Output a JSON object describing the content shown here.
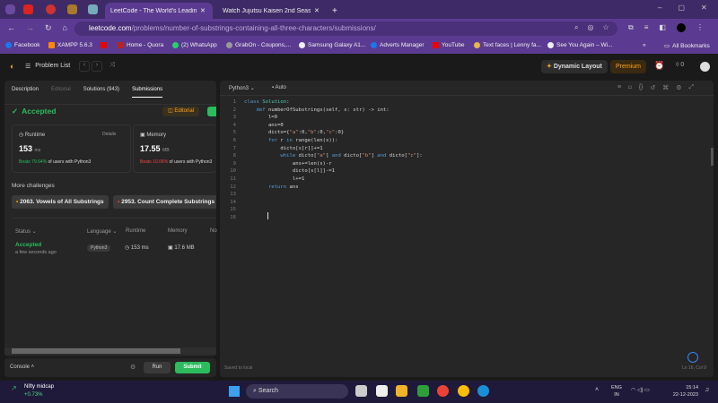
{
  "browser": {
    "tabs": [
      {
        "label": "LeetCode - The World's Leading",
        "active": true
      },
      {
        "label": "Watch Jujutsu Kaisen 2nd Seas",
        "active": false
      }
    ],
    "url_domain": "leetcode.com",
    "url_path": "/problems/number-of-substrings-containing-all-three-characters/submissions/",
    "bookmarks": [
      "Facebook",
      "XAMPP 5.6.3",
      "Home - Quora",
      "(2) WhatsApp",
      "GrabOn - Coupons,...",
      "Samsung Galaxy A1...",
      "Adverts Manager",
      "YouTube",
      "Text faces | Lenny fa...",
      "See You Again – Wi..."
    ],
    "all_bookmarks": "All Bookmarks",
    "more": "»"
  },
  "header": {
    "problem_list": "Problem List",
    "dynamic_layout": "Dynamic Layout",
    "premium": "Premium",
    "streak": "0"
  },
  "left": {
    "tabs": [
      "Description",
      "Editorial",
      "Solutions (943)",
      "Submissions"
    ],
    "status": "Accepted",
    "editorial_btn": "Editorial",
    "runtime": {
      "label": "Runtime",
      "details": "Details",
      "value": "153",
      "unit": "ms",
      "beats": "Beats 79.64%",
      "suffix": "of users with Python3"
    },
    "memory": {
      "label": "Memory",
      "value": "17.55",
      "unit": "MB",
      "beats": "Beats 10.06%",
      "suffix": "of users with Python3"
    },
    "more_challenges": "More challenges",
    "challenges": [
      "2063. Vowels of All Substrings",
      "2953. Count Complete Substrings"
    ],
    "table": {
      "headers": [
        "Status",
        "Language",
        "Runtime",
        "Memory",
        "No"
      ],
      "row": {
        "status": "Accepted",
        "time": "a few seconds ago",
        "language": "Python3",
        "runtime": "153 ms",
        "memory": "17.6 MB"
      }
    },
    "console": "Console",
    "run": "Run",
    "submit": "Submit"
  },
  "editor": {
    "language": "Python3",
    "mode": "Auto",
    "saved": "Saved to local",
    "cursor": "Ln 16, Col 9",
    "lines": [
      "class Solution:",
      "    def numberOfSubstrings(self, s: str) -> int:",
      "        l=0",
      "        ans=0",
      "        dicto={\"a\":0,\"b\":0,\"c\":0}",
      "        for r in range(len(s)):",
      "            dicto[s[r]]+=1",
      "            while dicto[\"a\"] and dicto[\"b\"] and dicto[\"c\"]:",
      "                ans+=len(s)-r",
      "                dicto[s[l]]-=1",
      "                l+=1",
      "        return ans",
      "",
      "",
      "",
      ""
    ]
  },
  "taskbar": {
    "widget_title": "Nifty midcap",
    "widget_value": "+0.73%",
    "search": "Search",
    "lang1": "ENG",
    "lang2": "IN",
    "time": "15:14",
    "date": "22-12-2023"
  },
  "colors": {
    "accent_green": "#2cbb5d",
    "red": "#ef4743",
    "premium": "#ffa116",
    "chrome_purple": "#5b3b91"
  }
}
